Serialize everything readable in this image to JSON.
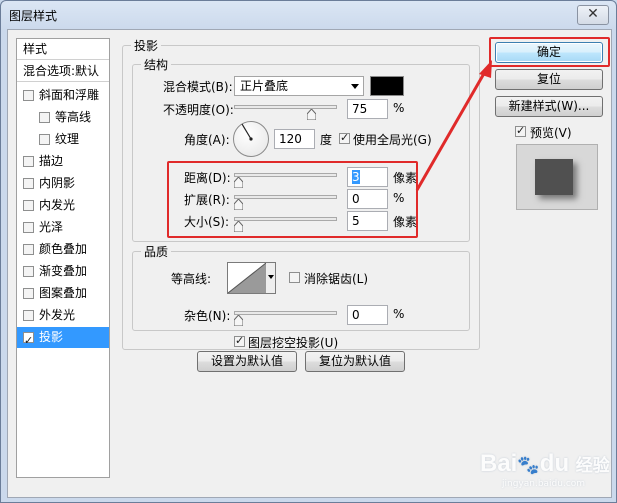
{
  "window": {
    "title": "图层样式",
    "close_glyph": "✕"
  },
  "sidebar": {
    "header_styles": "样式",
    "header_blend": "混合选项:默认",
    "items": [
      {
        "label": "斜面和浮雕",
        "checked": false
      },
      {
        "label": "等高线",
        "checked": false
      },
      {
        "label": "纹理",
        "checked": false
      },
      {
        "label": "描边",
        "checked": false
      },
      {
        "label": "内阴影",
        "checked": false
      },
      {
        "label": "内发光",
        "checked": false
      },
      {
        "label": "光泽",
        "checked": false
      },
      {
        "label": "颜色叠加",
        "checked": false
      },
      {
        "label": "渐变叠加",
        "checked": false
      },
      {
        "label": "图案叠加",
        "checked": false
      },
      {
        "label": "外发光",
        "checked": false
      },
      {
        "label": "投影",
        "checked": true,
        "selected": true
      }
    ]
  },
  "drop_shadow": {
    "section_title": "投影",
    "structure": {
      "title": "结构",
      "blend_mode_label": "混合模式(B):",
      "blend_mode_value": "正片叠底",
      "shadow_color": "#000000",
      "opacity_label": "不透明度(O):",
      "opacity_value": "75",
      "opacity_unit": "%",
      "opacity_fraction": 0.75,
      "angle_label": "角度(A):",
      "angle_value": "120",
      "angle_unit": "度",
      "global_light_label": "使用全局光(G)",
      "global_light_checked": true,
      "distance_label": "距离(D):",
      "distance_value": "3",
      "distance_unit": "像素",
      "spread_label": "扩展(R):",
      "spread_value": "0",
      "spread_unit": "%",
      "size_label": "大小(S):",
      "size_value": "5",
      "size_unit": "像素"
    },
    "quality": {
      "title": "品质",
      "contour_label": "等高线:",
      "antialias_label": "消除锯齿(L)",
      "antialias_checked": false,
      "noise_label": "杂色(N):",
      "noise_value": "0",
      "noise_unit": "%"
    },
    "knockout_label": "图层挖空投影(U)",
    "knockout_checked": true,
    "make_default_label": "设置为默认值",
    "reset_default_label": "复位为默认值"
  },
  "actions": {
    "ok_label": "确定",
    "reset_label": "复位",
    "new_style_label": "新建样式(W)...",
    "preview_label": "预览(V)",
    "preview_checked": true
  },
  "colors": {
    "highlight": "#e02a2a",
    "selection": "#3399ff"
  },
  "watermark": {
    "brand": "Bai",
    "brand_suffix": "du",
    "sub": "经验",
    "url": "jingyan.baidu.com"
  }
}
